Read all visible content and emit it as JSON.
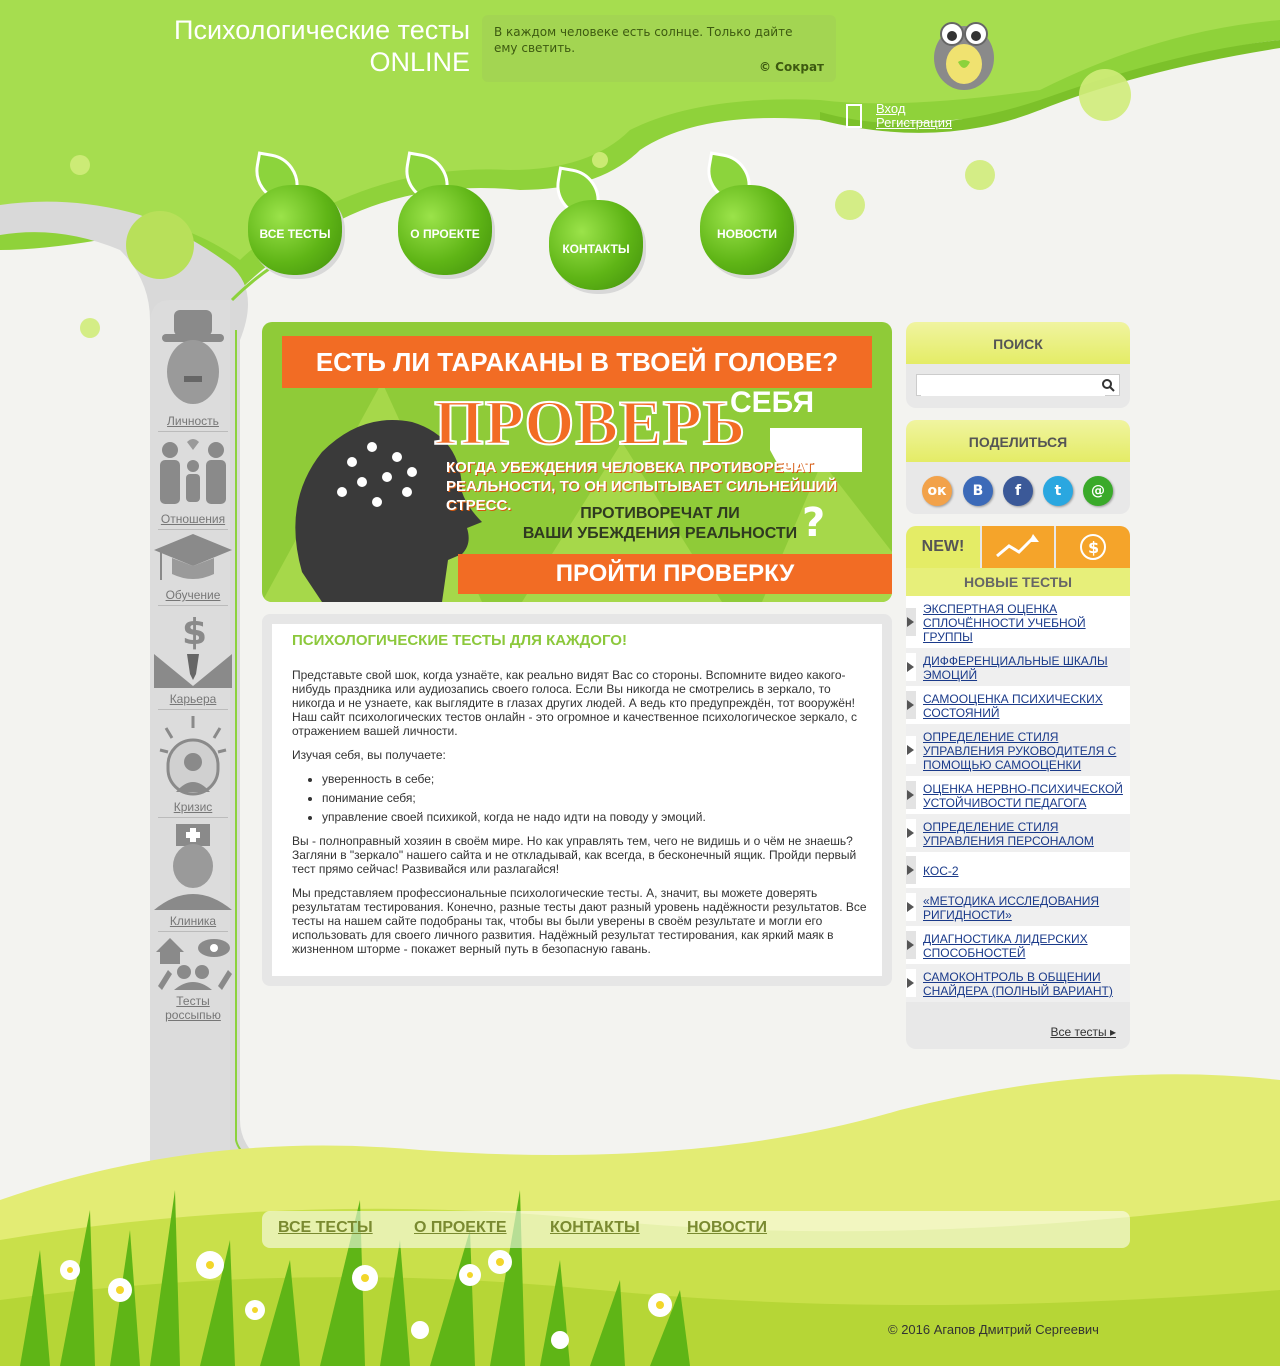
{
  "header": {
    "title_line1": "Психологические тесты",
    "title_line2": "ONLINE",
    "quote_text": "В каждом человеке есть солнце. Только дайте ему светить.",
    "quote_author": "© Сократ",
    "login_label": "Вход",
    "register_label": "Регистрация"
  },
  "nav": {
    "items": [
      "ВСЕ ТЕСТЫ",
      "О ПРОЕКТЕ",
      "КОНТАКТЫ",
      "НОВОСТИ"
    ]
  },
  "categories": [
    {
      "label": "Личность",
      "icon": "man-in-hat-icon"
    },
    {
      "label": "Отношения",
      "icon": "family-icon"
    },
    {
      "label": "Обучение",
      "icon": "graduation-cap-icon"
    },
    {
      "label": "Карьера",
      "icon": "businessman-dollar-icon"
    },
    {
      "label": "Кризис",
      "icon": "stressed-person-icon"
    },
    {
      "label": "Клиника",
      "icon": "nurse-icon"
    },
    {
      "label_line1": "Тесты",
      "label_line2": "россыпью",
      "icon": "house-eye-people-icon"
    }
  ],
  "banner": {
    "heading": "ЕСТЬ ЛИ ТАРАКАНЫ В ТВОЕЙ ГОЛОВЕ?",
    "big_word": "ПРОВЕРЬ",
    "big_word_suffix": "СЕБЯ",
    "statement_line1": "КОГДА УБЕЖДЕНИЯ ЧЕЛОВЕКА ПРОТИВОРЕЧАТ",
    "statement_line2": "РЕАЛЬНОСТИ, ТО ОН ИСПЫТЫВАЕТ СИЛЬНЕЙШИЙ СТРЕСС.",
    "question_line1": "ПРОТИВОРЕЧАТ ЛИ",
    "question_line2": "ВАШИ УБЕЖДЕНИЯ РЕАЛЬНОСТИ",
    "question_mark": "?",
    "button_label": "ПРОЙТИ ПРОВЕРКУ"
  },
  "content": {
    "heading": "ПСИХОЛОГИЧЕСКИЕ ТЕСТЫ ДЛЯ КАЖДОГО!",
    "p1": "Представьте свой шок, когда узнаёте, как реально видят Вас со стороны. Вспомните видео какого-нибудь праздника или аудиозапись своего голоса. Если Вы никогда не смотрелись в зеркало, то никогда и не узнаете, как выглядите в глазах других людей. А ведь кто предупреждён, тот вооружён! Наш сайт психологических тестов онлайн - это огромное и качественное психологическое зеркало, с отражением вашей личности.",
    "p2": "Изучая себя, вы получаете:",
    "bullets": [
      "уверенность в себе;",
      "понимание себя;",
      "управление своей психикой, когда не надо идти на поводу у эмоций."
    ],
    "p3": "Вы - полноправный хозяин в своём мире. Но как управлять тем, чего не видишь и о чём не знаешь? Загляни в \"зеркало\" нашего сайта и не откладывай, как всегда, в бесконечный ящик. Пройди первый тест прямо сейчас! Развивайся или разлагайся!",
    "p4": "Мы представляем профессиональные психологические тесты. А, значит, вы можете доверять результатам тестирования. Конечно, разные тесты дают разный уровень надёжности результатов. Все тесты на нашем сайте подобраны так, чтобы вы были уверены в своём результате и могли его использовать для своего личного развития. Надёжный результат тестирования, как яркий маяк в жизненном шторме - покажет верный путь в безопасную гавань."
  },
  "sidebar": {
    "search_title": "ПОИСК",
    "search_value": "",
    "share_title": "ПОДЕЛИТЬСЯ",
    "share_icons": [
      "odnoklassniki-icon",
      "vkontakte-icon",
      "facebook-icon",
      "twitter-icon",
      "mail-ru-icon"
    ],
    "share_glyphs": [
      "ок",
      "В",
      "f",
      "t",
      "@"
    ],
    "tab_new": "NEW!",
    "new_tests_title": "НОВЫЕ ТЕСТЫ",
    "tests": [
      "Экспертная оценка сплочённости учебной группы",
      "Дифференциальные шкалы эмоций",
      "Самооценка психических состояний",
      "Определение стиля управления руководителя с помощью самооценки",
      "Оценка нервно-психической устойчивости педагога",
      "Определение стиля управления персоналом",
      "КОС-2",
      "«Методика исследования ригидности»",
      "Диагностика лидерских способностей",
      "Самоконтроль в общении Снайдера (полный вариант)"
    ],
    "all_tests_label": "Все тесты"
  },
  "footer": {
    "nav": [
      "ВСЕ ТЕСТЫ",
      "О ПРОЕКТЕ",
      "КОНТАКТЫ",
      "НОВОСТИ"
    ],
    "copyright": "© 2016 Агапов Дмитрий Сергеевич"
  },
  "colors": {
    "green_main": "#8cd23c",
    "orange": "#f26c24",
    "link_blue": "#1a3a8a",
    "grass_yellow": "#e4ec66"
  }
}
